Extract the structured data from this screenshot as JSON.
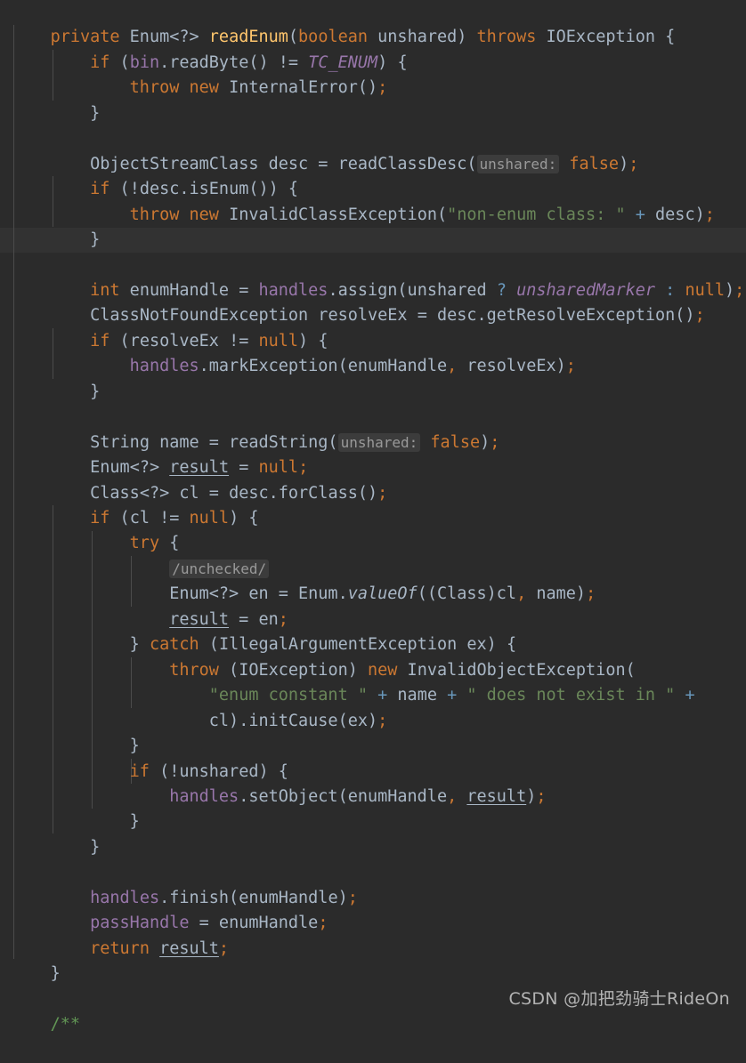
{
  "editor": {
    "theme": "darcula",
    "background": "#2B2B2B",
    "default_text_color": "#A9B7C6",
    "caret_line_background": "#323232",
    "indent_guide_color": "#4B4B4B",
    "font_size_px": 18.5,
    "line_height_px": 28.45,
    "caret_line_index": 9,
    "language": "Java",
    "colors": {
      "keyword": "#CC7832",
      "method_declaration": "#FFC66D",
      "field": "#9876AA",
      "static_field_italic": "#9876AA",
      "string": "#6A8759",
      "comment": "#629755",
      "number_operator": "#6897BB",
      "inlay_hint_text": "#878787",
      "inlay_hint_background": "#3B3B3B"
    }
  },
  "watermark": {
    "text": "CSDN @加把劲骑士RideOn"
  },
  "code": {
    "lines": [
      {
        "n": 1,
        "text": "private Enum<?> readEnum(boolean unshared) throws IOException {"
      },
      {
        "n": 2,
        "text": "    if (bin.readByte() != TC_ENUM) {"
      },
      {
        "n": 3,
        "text": "        throw new InternalError();"
      },
      {
        "n": 4,
        "text": "    }"
      },
      {
        "n": 5,
        "text": ""
      },
      {
        "n": 6,
        "text": "    ObjectStreamClass desc = readClassDesc( unshared: false);"
      },
      {
        "n": 7,
        "text": "    if (!desc.isEnum()) {"
      },
      {
        "n": 8,
        "text": "        throw new InvalidClassException(\"non-enum class: \" + desc);"
      },
      {
        "n": 9,
        "text": "    }"
      },
      {
        "n": 10,
        "text": ""
      },
      {
        "n": 11,
        "text": "    int enumHandle = handles.assign(unshared ? unsharedMarker : null);"
      },
      {
        "n": 12,
        "text": "    ClassNotFoundException resolveEx = desc.getResolveException();"
      },
      {
        "n": 13,
        "text": "    if (resolveEx != null) {"
      },
      {
        "n": 14,
        "text": "        handles.markException(enumHandle, resolveEx);"
      },
      {
        "n": 15,
        "text": "    }"
      },
      {
        "n": 16,
        "text": ""
      },
      {
        "n": 17,
        "text": "    String name = readString( unshared: false);"
      },
      {
        "n": 18,
        "text": "    Enum<?> result = null;"
      },
      {
        "n": 19,
        "text": "    Class<?> cl = desc.forClass();"
      },
      {
        "n": 20,
        "text": "    if (cl != null) {"
      },
      {
        "n": 21,
        "text": "        try {"
      },
      {
        "n": 22,
        "text": "            /unchecked/"
      },
      {
        "n": 23,
        "text": "            Enum<?> en = Enum.valueOf((Class)cl, name);"
      },
      {
        "n": 24,
        "text": "            result = en;"
      },
      {
        "n": 25,
        "text": "        } catch (IllegalArgumentException ex) {"
      },
      {
        "n": 26,
        "text": "            throw (IOException) new InvalidObjectException("
      },
      {
        "n": 27,
        "text": "                \"enum constant \" + name + \" does not exist in \" +"
      },
      {
        "n": 28,
        "text": "                cl).initCause(ex);"
      },
      {
        "n": 29,
        "text": "        }"
      },
      {
        "n": 30,
        "text": "        if (!unshared) {"
      },
      {
        "n": 31,
        "text": "            handles.setObject(enumHandle, result);"
      },
      {
        "n": 32,
        "text": "        }"
      },
      {
        "n": 33,
        "text": "    }"
      },
      {
        "n": 34,
        "text": ""
      },
      {
        "n": 35,
        "text": "    handles.finish(enumHandle);"
      },
      {
        "n": 36,
        "text": "    passHandle = enumHandle;"
      },
      {
        "n": 37,
        "text": "    return result;"
      },
      {
        "n": 38,
        "text": "}"
      },
      {
        "n": 39,
        "text": ""
      },
      {
        "n": 40,
        "text": "/**"
      }
    ],
    "inlay_hints": [
      {
        "line": 6,
        "text": "unshared:"
      },
      {
        "line": 17,
        "text": "unshared:"
      },
      {
        "line": 22,
        "text": "/unchecked/"
      }
    ],
    "underlined_identifiers": [
      "result"
    ],
    "keywords": [
      "private",
      "if",
      "throw",
      "new",
      "boolean",
      "throws",
      "int",
      "try",
      "catch",
      "return",
      "null",
      "false"
    ],
    "strings": [
      "\"non-enum class: \"",
      "\"enum constant \"",
      "\" does not exist in \""
    ],
    "comment_tokens": [
      "/**"
    ]
  }
}
